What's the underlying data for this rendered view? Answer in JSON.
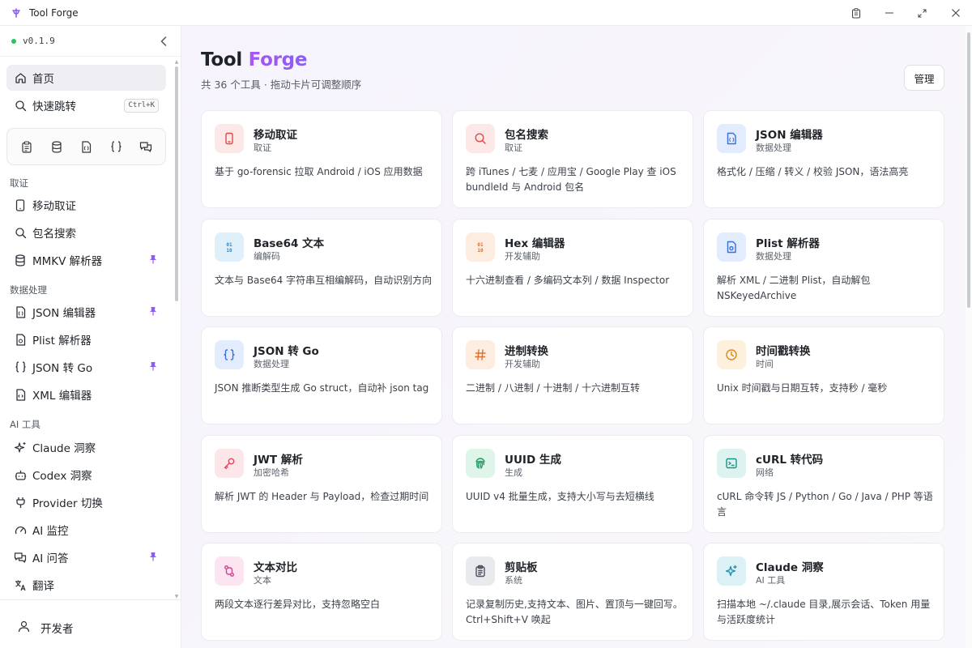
{
  "app": {
    "title": "Tool Forge"
  },
  "window_controls": [
    "clipboard-icon",
    "minimize-icon",
    "maximize-icon",
    "close-icon"
  ],
  "sidebar": {
    "version": "v0.1.9",
    "home": {
      "label": "首页",
      "icon": "home-icon"
    },
    "quick_jump": {
      "label": "快速跳转",
      "shortcut": "Ctrl+K",
      "icon": "search-icon"
    },
    "quick_tools": [
      "clipboard-icon",
      "database-icon",
      "json-file-icon",
      "braces-icon",
      "chat-icon"
    ],
    "sections": [
      {
        "title": "取证",
        "items": [
          {
            "label": "移动取证",
            "icon": "phone-icon",
            "pinned": false
          },
          {
            "label": "包名搜索",
            "icon": "search-icon",
            "pinned": false
          },
          {
            "label": "MMKV 解析器",
            "icon": "database-icon",
            "pinned": true
          }
        ]
      },
      {
        "title": "数据处理",
        "items": [
          {
            "label": "JSON 编辑器",
            "icon": "json-file-icon",
            "pinned": true
          },
          {
            "label": "Plist 解析器",
            "icon": "file-icon",
            "pinned": false
          },
          {
            "label": "JSON 转 Go",
            "icon": "braces-icon",
            "pinned": true
          },
          {
            "label": "XML 编辑器",
            "icon": "code-file-icon",
            "pinned": false
          }
        ]
      },
      {
        "title": "AI 工具",
        "items": [
          {
            "label": "Claude 洞察",
            "icon": "sparkle-icon",
            "pinned": false
          },
          {
            "label": "Codex 洞察",
            "icon": "bot-icon",
            "pinned": false
          },
          {
            "label": "Provider 切换",
            "icon": "plug-icon",
            "pinned": false
          },
          {
            "label": "AI 监控",
            "icon": "gauge-icon",
            "pinned": false
          },
          {
            "label": "AI 问答",
            "icon": "chat-icon",
            "pinned": true
          },
          {
            "label": "翻译",
            "icon": "translate-icon",
            "pinned": false
          }
        ]
      }
    ],
    "footer": {
      "label": "开发者",
      "icon": "user-icon"
    }
  },
  "main": {
    "title_plain": "Tool ",
    "title_accent": "Forge",
    "subtitle": "共 36 个工具 · 拖动卡片可调整顺序",
    "manage_label": "管理",
    "cards": [
      {
        "name": "移动取证",
        "category": "取证",
        "desc": "基于 go-forensic 拉取 Android / iOS 应用数据",
        "icon": "phone-icon",
        "bg": "#fde8e8",
        "color": "#e04848"
      },
      {
        "name": "包名搜索",
        "category": "取证",
        "desc": "跨 iTunes / 七麦 / 应用宝 / Google Play 查 iOS bundleId 与 Android 包名",
        "icon": "search-icon",
        "bg": "#fde8e8",
        "color": "#e04848"
      },
      {
        "name": "JSON 编辑器",
        "category": "数据处理",
        "desc": "格式化 / 压缩 / 转义 / 校验 JSON，语法高亮",
        "icon": "json-file-icon",
        "bg": "#e3ecfd",
        "color": "#3b6fd9"
      },
      {
        "name": "Base64 文本",
        "category": "编解码",
        "desc": "文本与 Base64 字符串互相编解码，自动识别方向",
        "icon": "binary-icon",
        "bg": "#e0f0fb",
        "color": "#2a86c7"
      },
      {
        "name": "Hex 编辑器",
        "category": "开发辅助",
        "desc": "十六进制查看 / 多编码文本列 / 数据 Inspector",
        "icon": "binary-icon",
        "bg": "#fdece0",
        "color": "#e0702e"
      },
      {
        "name": "Plist 解析器",
        "category": "数据处理",
        "desc": "解析 XML / 二进制 Plist，自动解包 NSKeyedArchive",
        "icon": "file-icon",
        "bg": "#e3ecfd",
        "color": "#3b6fd9"
      },
      {
        "name": "JSON 转 Go",
        "category": "数据处理",
        "desc": "JSON 推断类型生成 Go struct，自动补 json tag",
        "icon": "braces-icon",
        "bg": "#e3ecfd",
        "color": "#3b6fd9"
      },
      {
        "name": "进制转换",
        "category": "开发辅助",
        "desc": "二进制 / 八进制 / 十进制 / 十六进制互转",
        "icon": "hash-icon",
        "bg": "#fdece0",
        "color": "#e0702e"
      },
      {
        "name": "时间戳转换",
        "category": "时间",
        "desc": "Unix 时间戳与日期互转，支持秒 / 毫秒",
        "icon": "clock-icon",
        "bg": "#fdf0dc",
        "color": "#d9891c"
      },
      {
        "name": "JWT 解析",
        "category": "加密哈希",
        "desc": "解析 JWT 的 Header 与 Payload，检查过期时间",
        "icon": "key-icon",
        "bg": "#fde6ea",
        "color": "#d9475f"
      },
      {
        "name": "UUID 生成",
        "category": "生成",
        "desc": "UUID v4 批量生成，支持大小写与去短横线",
        "icon": "fingerprint-icon",
        "bg": "#dff5ea",
        "color": "#1f9d63"
      },
      {
        "name": "cURL 转代码",
        "category": "网络",
        "desc": "cURL 命令转 JS / Python / Go / Java / PHP 等语言",
        "icon": "terminal-icon",
        "bg": "#dcf3f0",
        "color": "#1b9488"
      },
      {
        "name": "文本对比",
        "category": "文本",
        "desc": "两段文本逐行差异对比，支持忽略空白",
        "icon": "diff-icon",
        "bg": "#fce4f1",
        "color": "#d0468f"
      },
      {
        "name": "剪贴板",
        "category": "系统",
        "desc": "记录复制历史,支持文本、图片、置顶与一键回写。Ctrl+Shift+V 唤起",
        "icon": "clipboard-icon",
        "bg": "#e8eaee",
        "color": "#4b5260"
      },
      {
        "name": "Claude 洞察",
        "category": "AI 工具",
        "desc": "扫描本地 ~/.claude 目录,展示会话、Token 用量与活跃度统计",
        "icon": "sparkle-icon",
        "bg": "#dcf1f6",
        "color": "#1f93ad"
      }
    ]
  }
}
